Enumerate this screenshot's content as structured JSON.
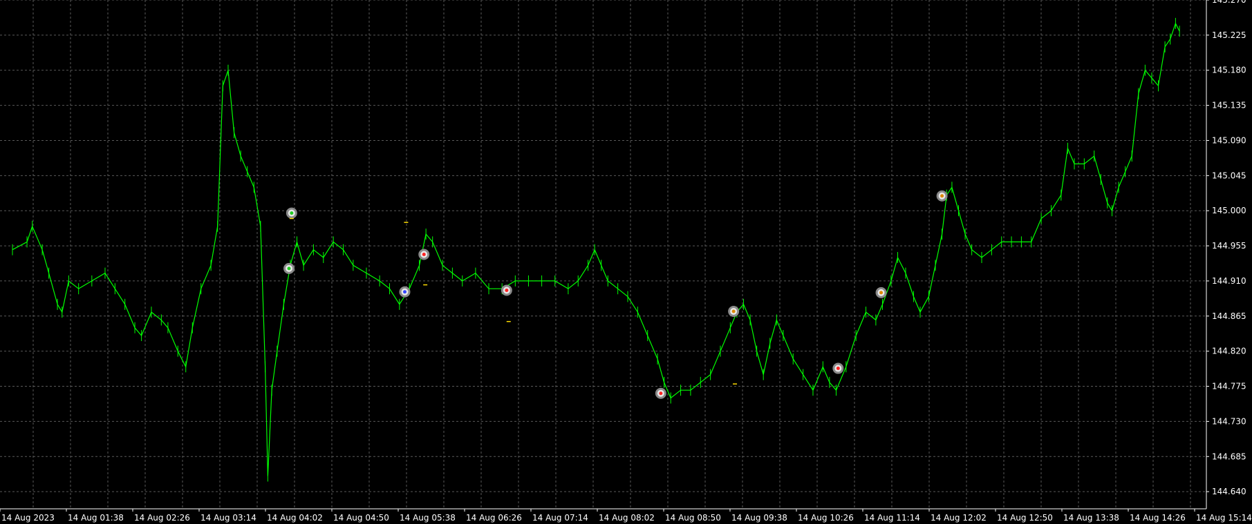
{
  "chart_data": {
    "type": "line",
    "title": "",
    "xlabel": "",
    "ylabel": "",
    "grid": true,
    "ylim": [
      144.618,
      145.27
    ],
    "x_tick_labels": [
      "14 Aug 2023",
      "14 Aug 01:38",
      "14 Aug 02:26",
      "14 Aug 03:14",
      "14 Aug 04:02",
      "14 Aug 04:50",
      "14 Aug 05:38",
      "14 Aug 06:26",
      "14 Aug 07:14",
      "14 Aug 08:02",
      "14 Aug 08:50",
      "14 Aug 09:38",
      "14 Aug 10:26",
      "14 Aug 11:14",
      "14 Aug 12:02",
      "14 Aug 12:50",
      "14 Aug 13:38",
      "14 Aug 14:26",
      "14 Aug 15:14"
    ],
    "y_tick_labels": [
      "145.270",
      "145.225",
      "145.180",
      "145.135",
      "145.090",
      "145.045",
      "145.000",
      "144.955",
      "144.910",
      "144.865",
      "144.820",
      "144.775",
      "144.730",
      "144.685",
      "144.640"
    ],
    "y_ticks": [
      145.27,
      145.225,
      145.18,
      145.135,
      145.09,
      145.045,
      145.0,
      144.955,
      144.91,
      144.865,
      144.82,
      144.775,
      144.73,
      144.685,
      144.64
    ],
    "x_range": [
      0,
      18.3
    ],
    "series": [
      {
        "color": "#00ff00",
        "style": "bars",
        "points": [
          [
            0.0,
            144.95
          ],
          [
            0.22,
            144.96
          ],
          [
            0.3,
            144.98
          ],
          [
            0.45,
            144.95
          ],
          [
            0.55,
            144.92
          ],
          [
            0.68,
            144.88
          ],
          [
            0.75,
            144.87
          ],
          [
            0.85,
            144.91
          ],
          [
            1.0,
            144.9
          ],
          [
            1.2,
            144.91
          ],
          [
            1.4,
            144.92
          ],
          [
            1.55,
            144.9
          ],
          [
            1.7,
            144.88
          ],
          [
            1.85,
            144.85
          ],
          [
            1.95,
            144.84
          ],
          [
            2.1,
            144.87
          ],
          [
            2.25,
            144.86
          ],
          [
            2.35,
            144.85
          ],
          [
            2.5,
            144.82
          ],
          [
            2.62,
            144.8
          ],
          [
            2.72,
            144.85
          ],
          [
            2.85,
            144.9
          ],
          [
            3.0,
            144.93
          ],
          [
            3.1,
            144.98
          ],
          [
            3.18,
            145.16
          ],
          [
            3.26,
            145.18
          ],
          [
            3.35,
            145.1
          ],
          [
            3.45,
            145.07
          ],
          [
            3.55,
            145.05
          ],
          [
            3.65,
            145.03
          ],
          [
            3.75,
            144.98
          ],
          [
            3.82,
            144.8
          ],
          [
            3.86,
            144.66
          ],
          [
            3.92,
            144.77
          ],
          [
            4.0,
            144.82
          ],
          [
            4.1,
            144.88
          ],
          [
            4.2,
            144.93
          ],
          [
            4.3,
            144.96
          ],
          [
            4.4,
            144.93
          ],
          [
            4.55,
            144.95
          ],
          [
            4.7,
            144.94
          ],
          [
            4.85,
            144.96
          ],
          [
            5.0,
            144.95
          ],
          [
            5.15,
            144.93
          ],
          [
            5.35,
            144.92
          ],
          [
            5.55,
            144.91
          ],
          [
            5.7,
            144.9
          ],
          [
            5.85,
            144.88
          ],
          [
            6.0,
            144.9
          ],
          [
            6.15,
            144.93
          ],
          [
            6.25,
            144.97
          ],
          [
            6.35,
            144.96
          ],
          [
            6.5,
            144.93
          ],
          [
            6.65,
            144.92
          ],
          [
            6.8,
            144.91
          ],
          [
            7.0,
            144.92
          ],
          [
            7.2,
            144.9
          ],
          [
            7.4,
            144.9
          ],
          [
            7.6,
            144.91
          ],
          [
            7.8,
            144.91
          ],
          [
            8.0,
            144.91
          ],
          [
            8.2,
            144.91
          ],
          [
            8.4,
            144.9
          ],
          [
            8.55,
            144.91
          ],
          [
            8.7,
            144.93
          ],
          [
            8.8,
            144.95
          ],
          [
            8.9,
            144.93
          ],
          [
            9.0,
            144.91
          ],
          [
            9.15,
            144.9
          ],
          [
            9.3,
            144.89
          ],
          [
            9.45,
            144.87
          ],
          [
            9.6,
            144.84
          ],
          [
            9.75,
            144.81
          ],
          [
            9.85,
            144.78
          ],
          [
            9.95,
            144.76
          ],
          [
            10.1,
            144.77
          ],
          [
            10.25,
            144.77
          ],
          [
            10.4,
            144.78
          ],
          [
            10.55,
            144.79
          ],
          [
            10.7,
            144.82
          ],
          [
            10.85,
            144.85
          ],
          [
            10.95,
            144.87
          ],
          [
            11.05,
            144.88
          ],
          [
            11.15,
            144.86
          ],
          [
            11.25,
            144.82
          ],
          [
            11.35,
            144.79
          ],
          [
            11.45,
            144.83
          ],
          [
            11.55,
            144.86
          ],
          [
            11.65,
            144.84
          ],
          [
            11.8,
            144.81
          ],
          [
            11.95,
            144.79
          ],
          [
            12.1,
            144.77
          ],
          [
            12.25,
            144.8
          ],
          [
            12.35,
            144.78
          ],
          [
            12.45,
            144.77
          ],
          [
            12.6,
            144.8
          ],
          [
            12.75,
            144.84
          ],
          [
            12.9,
            144.87
          ],
          [
            13.05,
            144.86
          ],
          [
            13.15,
            144.88
          ],
          [
            13.28,
            144.91
          ],
          [
            13.38,
            144.94
          ],
          [
            13.5,
            144.92
          ],
          [
            13.62,
            144.89
          ],
          [
            13.72,
            144.87
          ],
          [
            13.85,
            144.89
          ],
          [
            13.95,
            144.93
          ],
          [
            14.05,
            144.97
          ],
          [
            14.12,
            145.02
          ],
          [
            14.2,
            145.03
          ],
          [
            14.3,
            145.0
          ],
          [
            14.4,
            144.97
          ],
          [
            14.5,
            144.95
          ],
          [
            14.65,
            144.94
          ],
          [
            14.8,
            144.95
          ],
          [
            14.95,
            144.96
          ],
          [
            15.1,
            144.96
          ],
          [
            15.25,
            144.96
          ],
          [
            15.4,
            144.96
          ],
          [
            15.55,
            144.99
          ],
          [
            15.7,
            145.0
          ],
          [
            15.85,
            145.02
          ],
          [
            15.95,
            145.08
          ],
          [
            16.05,
            145.06
          ],
          [
            16.2,
            145.06
          ],
          [
            16.35,
            145.07
          ],
          [
            16.45,
            145.04
          ],
          [
            16.55,
            145.01
          ],
          [
            16.62,
            145.0
          ],
          [
            16.72,
            145.03
          ],
          [
            16.82,
            145.05
          ],
          [
            16.92,
            145.07
          ],
          [
            17.02,
            145.15
          ],
          [
            17.12,
            145.18
          ],
          [
            17.22,
            145.17
          ],
          [
            17.32,
            145.16
          ],
          [
            17.42,
            145.21
          ],
          [
            17.5,
            145.22
          ],
          [
            17.58,
            145.24
          ],
          [
            17.64,
            145.23
          ]
        ]
      }
    ],
    "markers": [
      {
        "x": 4.22,
        "y": 144.997,
        "color": "#22cc22"
      },
      {
        "x": 4.18,
        "y": 144.926,
        "color": "#22cc22"
      },
      {
        "x": 5.93,
        "y": 144.896,
        "color": "#3344ff"
      },
      {
        "x": 6.22,
        "y": 144.944,
        "color": "#ff2222"
      },
      {
        "x": 7.47,
        "y": 144.898,
        "color": "#ff2222"
      },
      {
        "x": 9.8,
        "y": 144.766,
        "color": "#ff2222"
      },
      {
        "x": 10.9,
        "y": 144.871,
        "color": "#dd8800"
      },
      {
        "x": 12.48,
        "y": 144.798,
        "color": "#ff2222"
      },
      {
        "x": 13.13,
        "y": 144.895,
        "color": "#dd8800"
      },
      {
        "x": 14.05,
        "y": 145.019,
        "color": "#dd8800"
      }
    ],
    "small_level_marks": [
      {
        "x": 4.22,
        "y": 144.99
      },
      {
        "x": 5.95,
        "y": 144.985
      },
      {
        "x": 6.24,
        "y": 144.905
      },
      {
        "x": 7.5,
        "y": 144.858
      },
      {
        "x": 10.92,
        "y": 144.778
      }
    ]
  }
}
